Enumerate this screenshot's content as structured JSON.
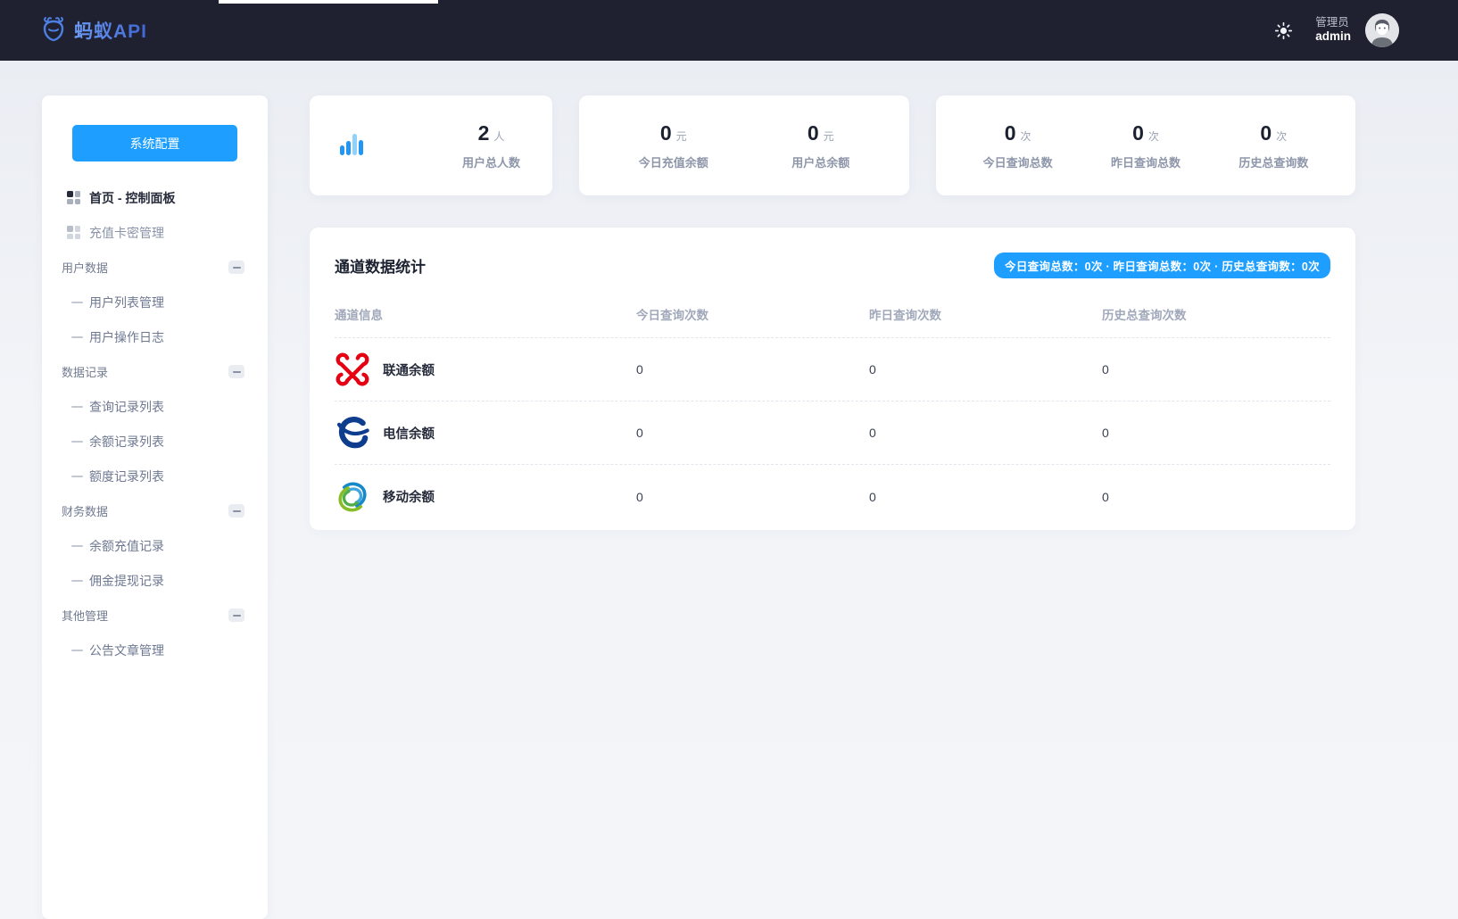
{
  "colors": {
    "accent_blue": "#1e9fff",
    "topbar_bg": "#1f2130",
    "unicom_red": "#e60012",
    "telecom_blue": "#0e3d8e",
    "mobile_blue": "#1789c9",
    "mobile_green": "#86bc25"
  },
  "icons": {
    "brand": "ant-icon",
    "theme_toggle": "sun-icon",
    "user": "person-avatar-icon",
    "stat_card": "bar-chart-icon",
    "menu_item": "grid-icon",
    "section_collapse": "minus-icon"
  },
  "header": {
    "logo_text": "蚂蚁API",
    "user_role": "管理员",
    "user_name": "admin"
  },
  "sidebar": {
    "config_button": "系统配置",
    "items": [
      {
        "type": "link",
        "label": "首页 - 控制面板",
        "active": true
      },
      {
        "type": "link",
        "label": "充值卡密管理",
        "active": false
      },
      {
        "type": "section",
        "label": "用户数据"
      },
      {
        "type": "child",
        "label": "用户列表管理"
      },
      {
        "type": "child",
        "label": "用户操作日志"
      },
      {
        "type": "section",
        "label": "数据记录"
      },
      {
        "type": "child",
        "label": "查询记录列表"
      },
      {
        "type": "child",
        "label": "余额记录列表"
      },
      {
        "type": "child",
        "label": "额度记录列表"
      },
      {
        "type": "section",
        "label": "财务数据"
      },
      {
        "type": "child",
        "label": "余额充值记录"
      },
      {
        "type": "child",
        "label": "佣金提现记录"
      },
      {
        "type": "section",
        "label": "其他管理"
      },
      {
        "type": "child",
        "label": "公告文章管理"
      }
    ]
  },
  "stats": {
    "cards": [
      {
        "items": [
          {
            "value": "2",
            "unit": "人",
            "label": "用户总人数"
          }
        ]
      },
      {
        "items": [
          {
            "value": "0",
            "unit": "元",
            "label": "今日充值余额"
          },
          {
            "value": "0",
            "unit": "元",
            "label": "用户总余额"
          }
        ]
      },
      {
        "items": [
          {
            "value": "0",
            "unit": "次",
            "label": "今日查询总数"
          },
          {
            "value": "0",
            "unit": "次",
            "label": "昨日查询总数"
          },
          {
            "value": "0",
            "unit": "次",
            "label": "历史总查询数"
          }
        ]
      }
    ]
  },
  "panel": {
    "title": "通道数据统计",
    "badge": "今日查询总数：0次 · 昨日查询总数：0次 · 历史总查询数：0次",
    "table": {
      "headers": [
        "通道信息",
        "今日查询次数",
        "昨日查询次数",
        "历史总查询次数"
      ],
      "rows": [
        {
          "logo": "unicom-logo",
          "channel": "联通余额",
          "today": "0",
          "yesterday": "0",
          "total": "0"
        },
        {
          "logo": "telecom-logo",
          "channel": "电信余额",
          "today": "0",
          "yesterday": "0",
          "total": "0"
        },
        {
          "logo": "mobile-logo",
          "channel": "移动余额",
          "today": "0",
          "yesterday": "0",
          "total": "0"
        }
      ]
    }
  }
}
